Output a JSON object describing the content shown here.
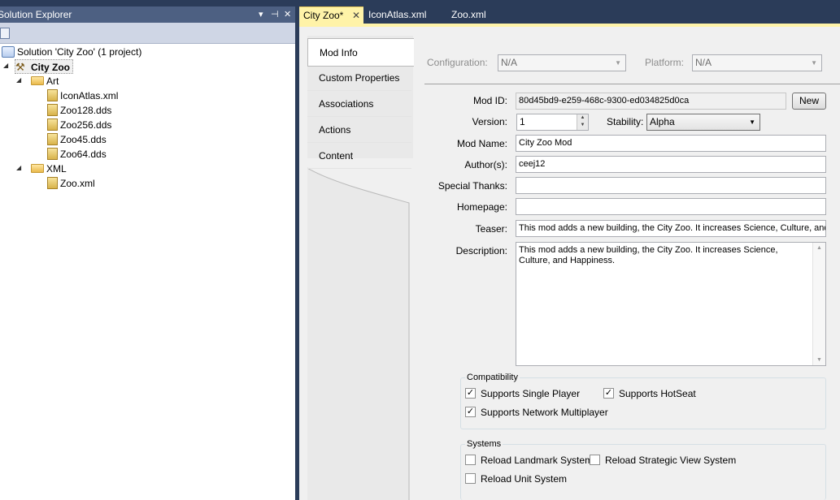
{
  "solution_explorer": {
    "title": "Solution Explorer",
    "pin_label": "▾ ⊣ ✕",
    "tree": {
      "solution": "Solution 'City Zoo' (1 project)",
      "project": "City Zoo",
      "art_folder": "Art",
      "art_files": [
        "IconAtlas.xml",
        "Zoo128.dds",
        "Zoo256.dds",
        "Zoo45.dds",
        "Zoo64.dds"
      ],
      "xml_folder": "XML",
      "xml_files": [
        "Zoo.xml"
      ]
    }
  },
  "doc_tabs": [
    {
      "label": "City Zoo*",
      "close": "✕",
      "active": true
    },
    {
      "label": "IconAtlas.xml",
      "active": false
    },
    {
      "label": "Zoo.xml",
      "active": false
    }
  ],
  "nav": {
    "tabs": [
      "Mod Info",
      "Custom Properties",
      "Associations",
      "Actions",
      "Content"
    ],
    "selected": "Mod Info"
  },
  "config": {
    "configuration_label": "Configuration:",
    "configuration_value": "N/A",
    "platform_label": "Platform:",
    "platform_value": "N/A"
  },
  "form": {
    "mod_id_label": "Mod ID:",
    "mod_id_value": "80d45bd9-e259-468c-9300-ed034825d0ca",
    "new_button": "New",
    "version_label": "Version:",
    "version_value": "1",
    "stability_label": "Stability:",
    "stability_value": "Alpha",
    "mod_name_label": "Mod Name:",
    "mod_name_value": "City Zoo Mod",
    "authors_label": "Author(s):",
    "authors_value": "ceej12",
    "special_thanks_label": "Special Thanks:",
    "special_thanks_value": "",
    "homepage_label": "Homepage:",
    "homepage_value": "",
    "teaser_label": "Teaser:",
    "teaser_value": "This mod adds a new building, the City Zoo. It increases Science, Culture, and",
    "description_label": "Description:",
    "description_value": "This mod adds a new building, the City Zoo. It increases Science, Culture, and Happiness."
  },
  "compatibility": {
    "title": "Compatibility",
    "single_player": {
      "label": "Supports Single Player",
      "checked": true
    },
    "hotseat": {
      "label": "Supports HotSeat",
      "checked": true
    },
    "network": {
      "label": "Supports Network Multiplayer",
      "checked": true
    }
  },
  "systems": {
    "title": "Systems",
    "landmark": {
      "label": "Reload Landmark System",
      "checked": false
    },
    "strategic": {
      "label": "Reload Strategic View System",
      "checked": false
    },
    "unit": {
      "label": "Reload Unit System",
      "checked": false
    }
  },
  "icons": {
    "check": "✓",
    "dropdown": "▼",
    "expanded": "◢"
  }
}
